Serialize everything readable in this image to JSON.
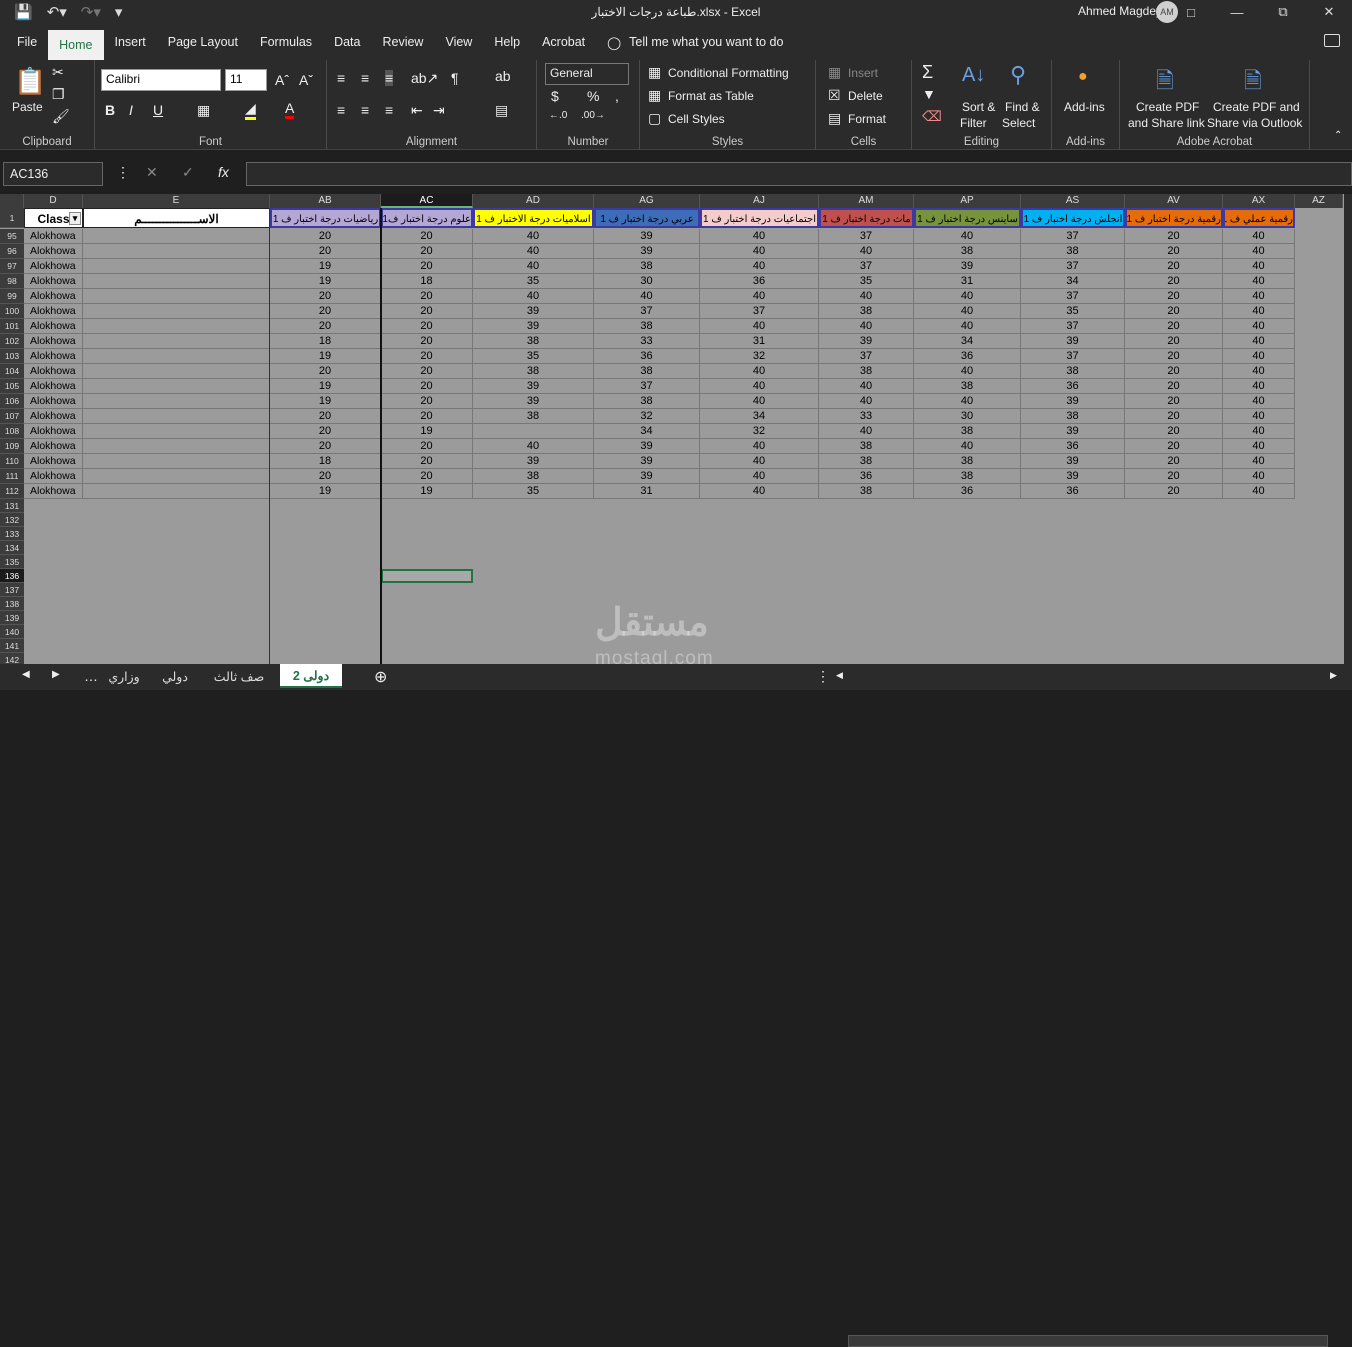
{
  "window": {
    "title": "طباعة درجات الاختبار.xlsx  -  Excel",
    "user": "Ahmed Magdey",
    "avatar": "AM"
  },
  "menu": [
    "File",
    "Home",
    "Insert",
    "Page Layout",
    "Formulas",
    "Data",
    "Review",
    "View",
    "Help",
    "Acrobat"
  ],
  "tell_me": "Tell me what you want to do",
  "ribbon": {
    "clipboard": {
      "paste": "Paste",
      "label": "Clipboard"
    },
    "font": {
      "name": "Calibri",
      "size": "11",
      "label": "Font"
    },
    "alignment": {
      "label": "Alignment"
    },
    "number": {
      "format": "General",
      "label": "Number"
    },
    "styles": {
      "cond": "Conditional Formatting",
      "table": "Format as Table",
      "cell": "Cell Styles",
      "label": "Styles"
    },
    "cells": {
      "insert": "Insert",
      "delete": "Delete",
      "format": "Format",
      "label": "Cells"
    },
    "editing": {
      "sort1": "Sort &",
      "sort2": "Filter",
      "find1": "Find &",
      "find2": "Select",
      "label": "Editing"
    },
    "addins": {
      "btn": "Add-ins",
      "label": "Add-ins"
    },
    "acrobat": {
      "c1a": "Create PDF",
      "c1b": "and Share link",
      "c2a": "Create PDF and",
      "c2b": "Share via Outlook",
      "label": "Adobe Acrobat"
    }
  },
  "namebox": "AC136",
  "columns": [
    "D",
    "E",
    "AB",
    "AC",
    "AD",
    "AG",
    "AJ",
    "AM",
    "AP",
    "AS",
    "AV",
    "AX",
    "AZ"
  ],
  "headers": [
    "Class",
    "الاســــــــــــــــم",
    "رياضيات درجة اختبار ف 1",
    "علوم درجة اختبار ف1",
    "اسلاميات درجة الاختبار ف 1",
    "عربي درجة اختبار ف 1",
    "اجتماعيات درجة اختبار ف 1",
    "ماث درجة اختبار ف 1",
    "ساينس درجة اختبار ف 1",
    "انجلش درجة اختبار ف 1",
    "رقمية درجة اختبار ف 1",
    "رقمية عملي ف 1"
  ],
  "header_colors": [
    "#ffffff",
    "#ffffff",
    "#b4a7d6",
    "#b4a7d6",
    "#ffff00",
    "#3d6cb9",
    "#f4cccc",
    "#c0504d",
    "#77933c",
    "#00b0f0",
    "#e46c0a",
    "#e46c0a"
  ],
  "rows": [
    {
      "n": "95",
      "v": [
        "Alokhowa",
        "",
        "20",
        "20",
        "40",
        "39",
        "40",
        "37",
        "40",
        "37",
        "20",
        "40"
      ]
    },
    {
      "n": "96",
      "v": [
        "Alokhowa",
        "",
        "20",
        "20",
        "40",
        "39",
        "40",
        "40",
        "38",
        "38",
        "20",
        "40"
      ]
    },
    {
      "n": "97",
      "v": [
        "Alokhowa",
        "",
        "19",
        "20",
        "40",
        "38",
        "40",
        "37",
        "39",
        "37",
        "20",
        "40"
      ]
    },
    {
      "n": "98",
      "v": [
        "Alokhowa",
        "",
        "19",
        "18",
        "35",
        "30",
        "36",
        "35",
        "31",
        "34",
        "20",
        "40"
      ]
    },
    {
      "n": "99",
      "v": [
        "Alokhowa",
        "",
        "20",
        "20",
        "40",
        "40",
        "40",
        "40",
        "40",
        "37",
        "20",
        "40"
      ]
    },
    {
      "n": "100",
      "v": [
        "Alokhowa",
        "",
        "20",
        "20",
        "39",
        "37",
        "37",
        "38",
        "40",
        "35",
        "20",
        "40"
      ]
    },
    {
      "n": "101",
      "v": [
        "Alokhowa",
        "",
        "20",
        "20",
        "39",
        "38",
        "40",
        "40",
        "40",
        "37",
        "20",
        "40"
      ]
    },
    {
      "n": "102",
      "v": [
        "Alokhowa",
        "",
        "18",
        "20",
        "38",
        "33",
        "31",
        "39",
        "34",
        "39",
        "20",
        "40"
      ]
    },
    {
      "n": "103",
      "v": [
        "Alokhowa",
        "",
        "19",
        "20",
        "35",
        "36",
        "32",
        "37",
        "36",
        "37",
        "20",
        "40"
      ]
    },
    {
      "n": "104",
      "v": [
        "Alokhowa",
        "",
        "20",
        "20",
        "38",
        "38",
        "40",
        "38",
        "40",
        "38",
        "20",
        "40"
      ]
    },
    {
      "n": "105",
      "v": [
        "Alokhowa",
        "",
        "19",
        "20",
        "39",
        "37",
        "40",
        "40",
        "38",
        "36",
        "20",
        "40"
      ]
    },
    {
      "n": "106",
      "v": [
        "Alokhowa",
        "",
        "19",
        "20",
        "39",
        "38",
        "40",
        "40",
        "40",
        "39",
        "20",
        "40"
      ]
    },
    {
      "n": "107",
      "v": [
        "Alokhowa",
        "",
        "20",
        "20",
        "38",
        "32",
        "34",
        "33",
        "30",
        "38",
        "20",
        "40"
      ]
    },
    {
      "n": "108",
      "v": [
        "Alokhowa",
        "",
        "20",
        "19",
        "",
        "34",
        "32",
        "40",
        "38",
        "39",
        "20",
        "40"
      ]
    },
    {
      "n": "109",
      "v": [
        "Alokhowa",
        "",
        "20",
        "20",
        "40",
        "39",
        "40",
        "38",
        "40",
        "36",
        "20",
        "40"
      ]
    },
    {
      "n": "110",
      "v": [
        "Alokhowa",
        "",
        "18",
        "20",
        "39",
        "39",
        "40",
        "38",
        "38",
        "39",
        "20",
        "40"
      ]
    },
    {
      "n": "111",
      "v": [
        "Alokhowa",
        "",
        "20",
        "20",
        "38",
        "39",
        "40",
        "36",
        "38",
        "39",
        "20",
        "40"
      ]
    },
    {
      "n": "112",
      "v": [
        "Alokhowa",
        "",
        "19",
        "19",
        "35",
        "31",
        "40",
        "38",
        "36",
        "36",
        "20",
        "40"
      ]
    }
  ],
  "empty_rows": [
    "131",
    "132",
    "133",
    "134",
    "135",
    "136",
    "137",
    "138",
    "139",
    "140",
    "141",
    "142"
  ],
  "selected_row": "136",
  "tabs": [
    "وزاري",
    "دولي",
    "صف ثالث",
    "دولى 2"
  ],
  "watermark": "مستقل",
  "watermark_sub": "mostaql.com"
}
